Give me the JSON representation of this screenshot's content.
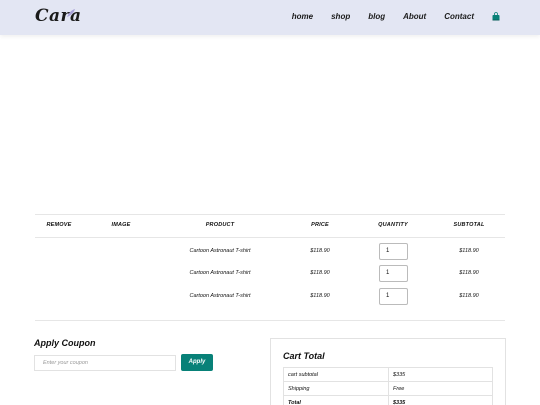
{
  "brand": {
    "logo_text": "Cara",
    "accent": "#088178"
  },
  "nav": {
    "items": [
      "home",
      "shop",
      "blog",
      "About",
      "Contact"
    ],
    "cart_icon": "shopping-bag-icon"
  },
  "table": {
    "headers": [
      "REMOVE",
      "IMAGE",
      "PRODUCT",
      "PRICE",
      "QUANTITY",
      "SUBTOTAL"
    ],
    "rows": [
      {
        "product": "Cartoon Astronaut T-shirt",
        "price": "$118.90",
        "quantity": "1",
        "subtotal": "$118.90"
      },
      {
        "product": "Cartoon Astronaut T-shirt",
        "price": "$118.90",
        "quantity": "1",
        "subtotal": "$118.90"
      },
      {
        "product": "Cartoon Astronaut T-shirt",
        "price": "$118.90",
        "quantity": "1",
        "subtotal": "$118.90"
      }
    ]
  },
  "coupon": {
    "title": "Apply Coupon",
    "placeholder": "Enter your coupon",
    "button_label": "Apply"
  },
  "cart_total": {
    "title": "Cart Total",
    "rows": [
      {
        "label": "cart subtotal",
        "value": "$335"
      },
      {
        "label": "Shipping",
        "value": "Free"
      },
      {
        "label": "Total",
        "value": "$335"
      }
    ]
  }
}
